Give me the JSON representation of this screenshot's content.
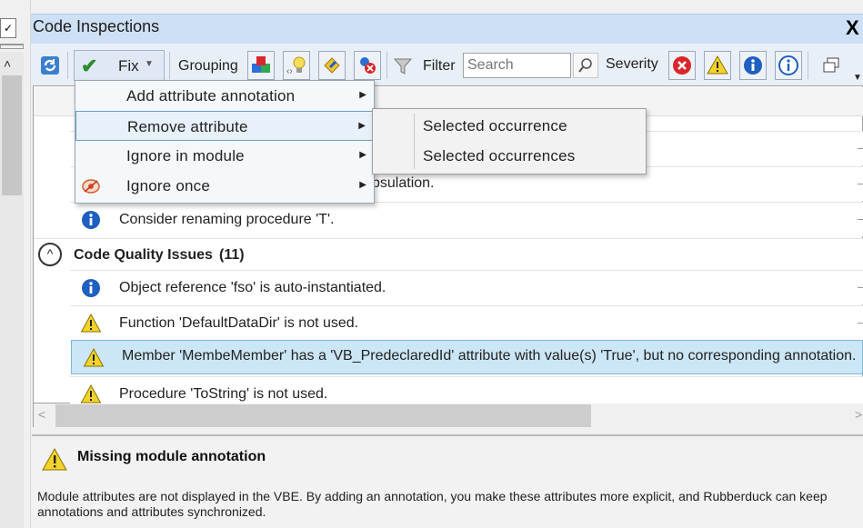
{
  "window": {
    "title": "Code Inspections",
    "close_glyph": "X"
  },
  "left_strip": {
    "combo_glyph": "✓",
    "scroll_up_glyph": "˄"
  },
  "toolbar": {
    "fix_label": "Fix",
    "grouping_label": "Grouping",
    "filter_label": "Filter",
    "search_placeholder": "Search",
    "severity_label": "Severity",
    "icons": [
      "refresh-icon",
      "group-by-type-icon",
      "group-by-location-icon",
      "group-by-module-icon",
      "group-by-severity-icon",
      "filter-icon",
      "search-icon",
      "error-severity-icon",
      "warning-severity-icon",
      "suggestion-severity-icon",
      "hint-severity-icon",
      "copy-results-icon"
    ]
  },
  "fix_menu": {
    "items": [
      {
        "label": "Add attribute annotation",
        "icon": ""
      },
      {
        "label": "Remove attribute",
        "icon": ""
      },
      {
        "label": "Ignore in module",
        "icon": ""
      },
      {
        "label": "Ignore once",
        "icon": "ignore-once-icon"
      }
    ],
    "submenu": {
      "items": [
        {
          "label": "Selected occurrence"
        },
        {
          "label": "Selected occurrences"
        }
      ]
    }
  },
  "results": {
    "partial_text_under_menu": "psulation.",
    "rows_before_group": [
      {
        "severity": "info",
        "text": "Consider renaming procedure 'T'."
      }
    ],
    "group": {
      "title": "Code Quality Issues",
      "count": "(11)",
      "toggle_glyph": "^"
    },
    "rows": [
      {
        "severity": "info",
        "text": "Object reference 'fso' is auto-instantiated."
      },
      {
        "severity": "warning",
        "text": "Function 'DefaultDataDir' is not used."
      },
      {
        "severity": "warning",
        "text": "Member 'MembeMember' has a 'VB_PredeclaredId' attribute with value(s) 'True', but no corresponding annotation.",
        "selected": true
      },
      {
        "severity": "warning",
        "text": "Procedure 'ToString' is not used."
      }
    ]
  },
  "scrollbar": {
    "left_glyph": "<",
    "right_glyph": ">"
  },
  "details": {
    "title": "Missing module annotation",
    "description": "Module attributes are not displayed in the VBE. By adding an annotation, you make these attributes more explicit, and Rubberduck can keep annotations and attributes synchronized."
  },
  "colors": {
    "title_bar": "#cde0f5",
    "toolbar": "#e9eff7",
    "selected_row": "#cbe6f6",
    "error": "#d9262a",
    "warning": "#f2d22b",
    "info": "#1e5fc1"
  }
}
